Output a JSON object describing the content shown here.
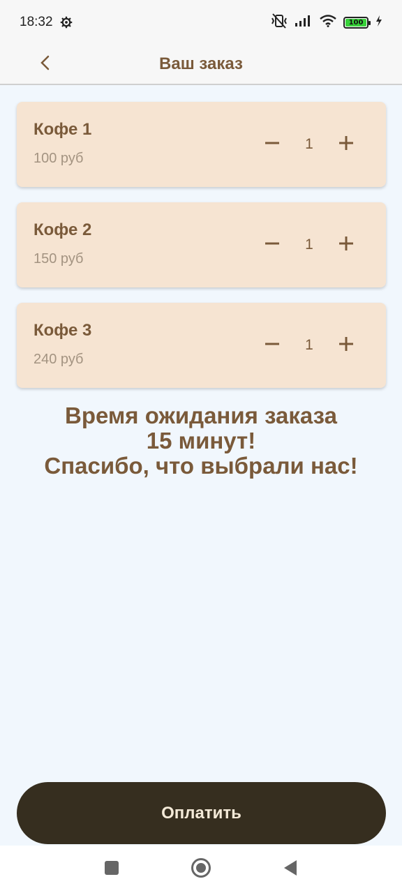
{
  "status_bar": {
    "time": "18:32",
    "battery": "100"
  },
  "app_bar": {
    "title": "Ваш заказ"
  },
  "items": [
    {
      "name": "Кофе 1",
      "price": "100 руб",
      "quantity": "1"
    },
    {
      "name": "Кофе 2",
      "price": "150 руб",
      "quantity": "1"
    },
    {
      "name": "Кофе 3",
      "price": "240 руб",
      "quantity": "1"
    }
  ],
  "message": {
    "line1": "Время ожидания заказа",
    "line2": "15 минут!",
    "line3": "Спасибо, что выбрали нас!"
  },
  "pay_button": {
    "label": "Оплатить"
  },
  "colors": {
    "accent": "#7a5a3a",
    "card_bg": "#f6e4d2",
    "pay_bg": "#362e1f",
    "page_bg": "#f1f7fd"
  }
}
